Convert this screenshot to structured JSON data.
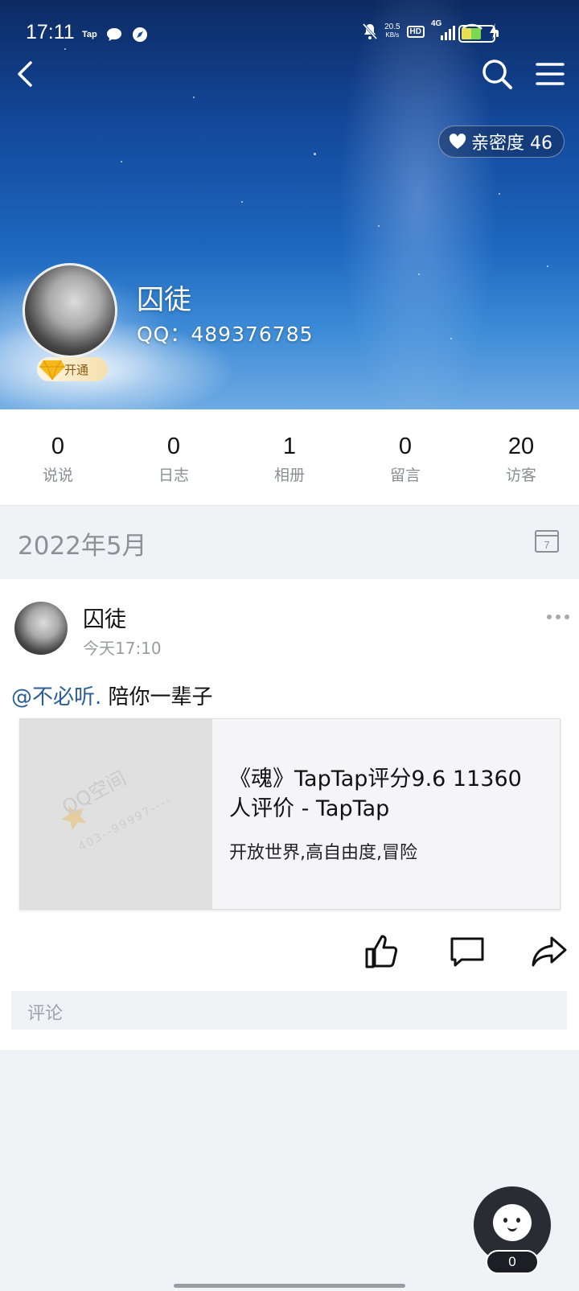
{
  "status_bar": {
    "time": "17:11",
    "app_tag": "Tap",
    "speed_value": "20.5",
    "speed_unit": "KB/s",
    "hd": "HD",
    "network": "4G",
    "icons": [
      "chat-bubble-icon",
      "compass-icon",
      "mute-bell-icon",
      "wifi-icon",
      "charging-icon",
      "battery-icon"
    ]
  },
  "header": {
    "back_icon": "chevron-left-icon",
    "search_icon": "search-icon",
    "menu_icon": "menu-icon",
    "intimacy_label": "亲密度 46"
  },
  "profile": {
    "name": "囚徒",
    "qq": "QQ：489376785",
    "vip_label": "开通"
  },
  "stats": [
    {
      "value": "0",
      "label": "说说"
    },
    {
      "value": "0",
      "label": "日志"
    },
    {
      "value": "1",
      "label": "相册"
    },
    {
      "value": "0",
      "label": "留言"
    },
    {
      "value": "20",
      "label": "访客"
    }
  ],
  "month_header": {
    "label": "2022年5月",
    "calendar_day": "7"
  },
  "post": {
    "author": "囚徒",
    "time": "今天17:10",
    "mention": "@不必听.",
    "text": " 陪你一辈子",
    "link": {
      "thumb_watermark": "QQ空间",
      "thumb_watermark_sub": "403--99997----",
      "title": "《魂》TapTap评分9.6 11360人评价 - TapTap",
      "desc": "开放世界,高自由度,冒险"
    },
    "actions": [
      "thumbs-up-icon",
      "comment-icon",
      "share-icon"
    ],
    "comment_placeholder": "评论"
  },
  "floating": {
    "count": "0"
  },
  "colors": {
    "mention": "#2a5e96",
    "page_bg": "#f1f2f6"
  }
}
